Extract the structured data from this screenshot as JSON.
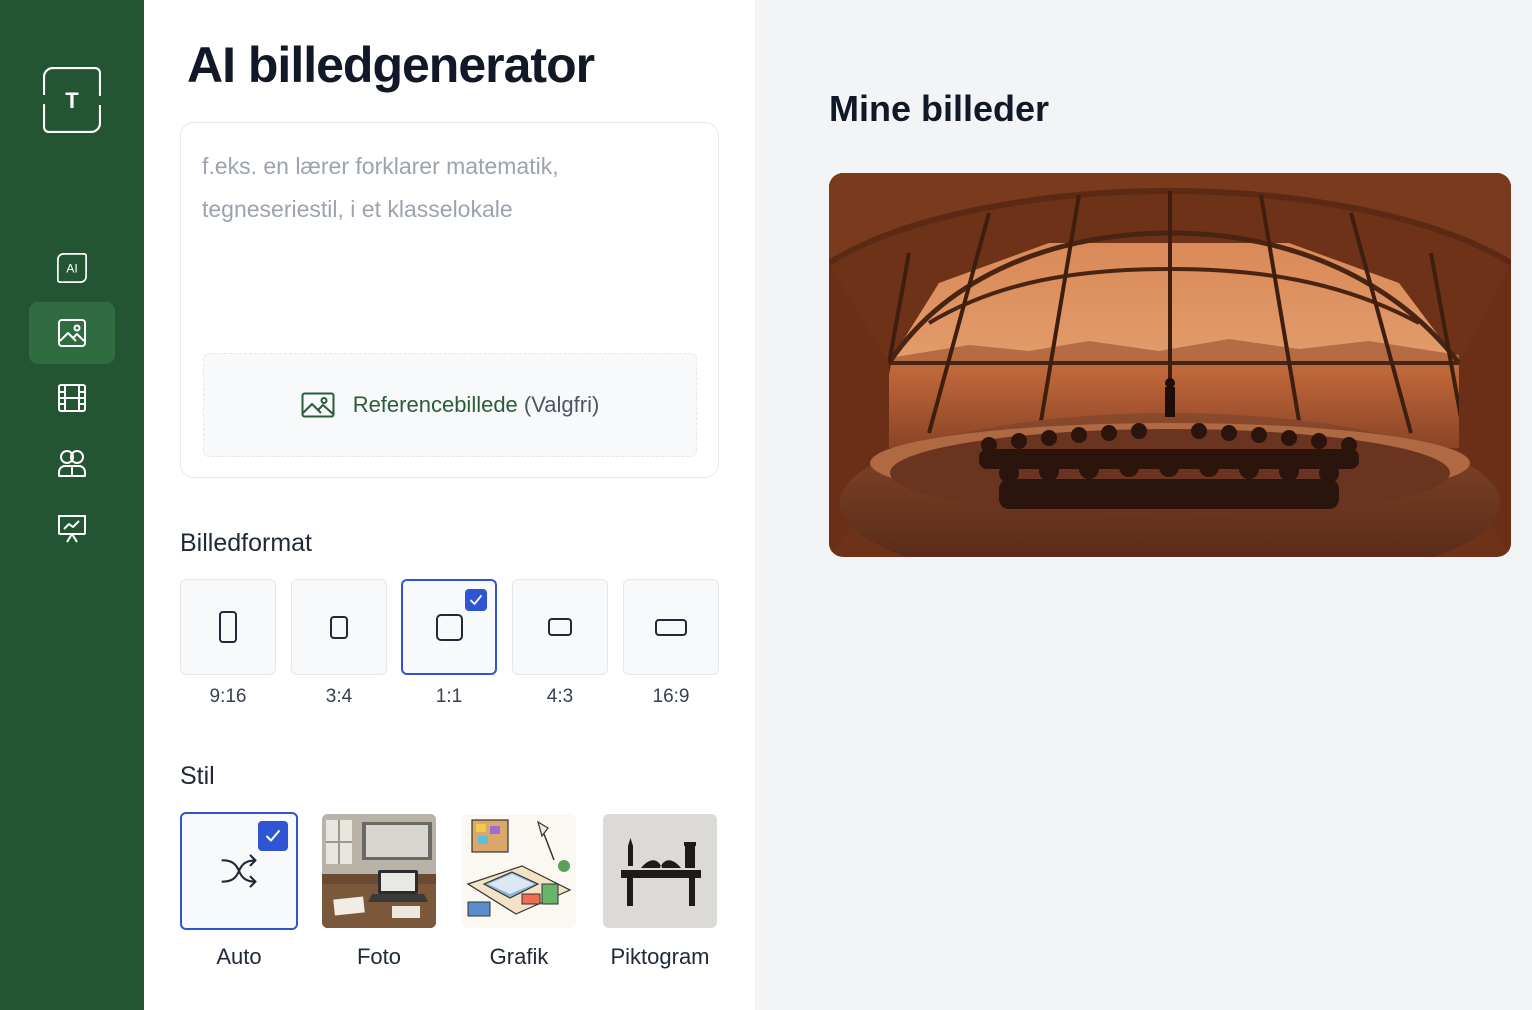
{
  "sidebar": {
    "logo_letter": "T",
    "nav": [
      {
        "name": "ai-text",
        "label": "AI"
      },
      {
        "name": "images"
      },
      {
        "name": "video"
      },
      {
        "name": "users"
      },
      {
        "name": "presentation"
      }
    ],
    "active_index": 1,
    "bg_color": "#245532",
    "active_color": "#2f6d40"
  },
  "page": {
    "title": "AI billedgenerator"
  },
  "prompt": {
    "placeholder": "f.eks. en lærer forklarer matematik, tegneseriestil, i et klasselokale",
    "value": "",
    "reference_label": "Referencebillede",
    "reference_optional": "(Valgfri)"
  },
  "format": {
    "label": "Billedformat",
    "options": [
      "9:16",
      "3:4",
      "1:1",
      "4:3",
      "16:9"
    ],
    "selected": "1:1"
  },
  "style": {
    "label": "Stil",
    "options": [
      "Auto",
      "Foto",
      "Grafik",
      "Piktogram"
    ],
    "selected": "Auto"
  },
  "gallery": {
    "title": "Mine billeder"
  },
  "colors": {
    "accent_blue": "#2f55d4",
    "brand_green": "#245532"
  }
}
